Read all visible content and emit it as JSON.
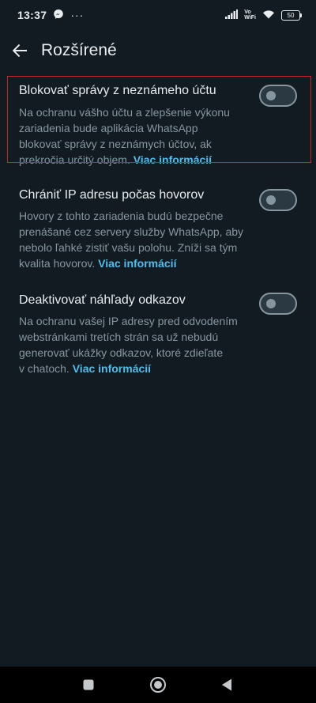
{
  "status_bar": {
    "time": "13:37",
    "dots": "···",
    "volte_top": "Vo",
    "volte_bottom": "WiFi",
    "battery": "50"
  },
  "app_bar": {
    "title": "Rozšírené"
  },
  "settings": [
    {
      "title": "Blokovať správy z neznámeho účtu",
      "description_lines": [
        "Na ochranu vášho účtu a zlepšenie výkonu",
        "zariadenia bude aplikácia WhatsApp",
        "blokovať správy z neznámych účtov, ak",
        "prekročia určitý objem."
      ],
      "link": "Viac informácií",
      "enabled": false
    },
    {
      "title": "Chrániť IP adresu počas hovorov",
      "description_lines": [
        "Hovory z tohto zariadenia budú bezpečne",
        "prenášané cez servery služby WhatsApp, aby",
        "nebolo ľahké zistiť vašu polohu. Zníži sa tým",
        "kvalita hovorov."
      ],
      "link": "Viac informácií",
      "enabled": false
    },
    {
      "title": "Deaktivovať náhľady odkazov",
      "description_lines": [
        "Na ochranu vašej IP adresy pred odvodením",
        "webstránkami tretích strán sa už nebudú",
        "generovať ukážky odkazov, ktoré zdieľate",
        "v chatoch."
      ],
      "link": "Viac informácií",
      "enabled": false
    }
  ],
  "colors": {
    "background": "#121b22",
    "accent_link": "#53bdeb",
    "highlight_border": "#c0282b"
  }
}
